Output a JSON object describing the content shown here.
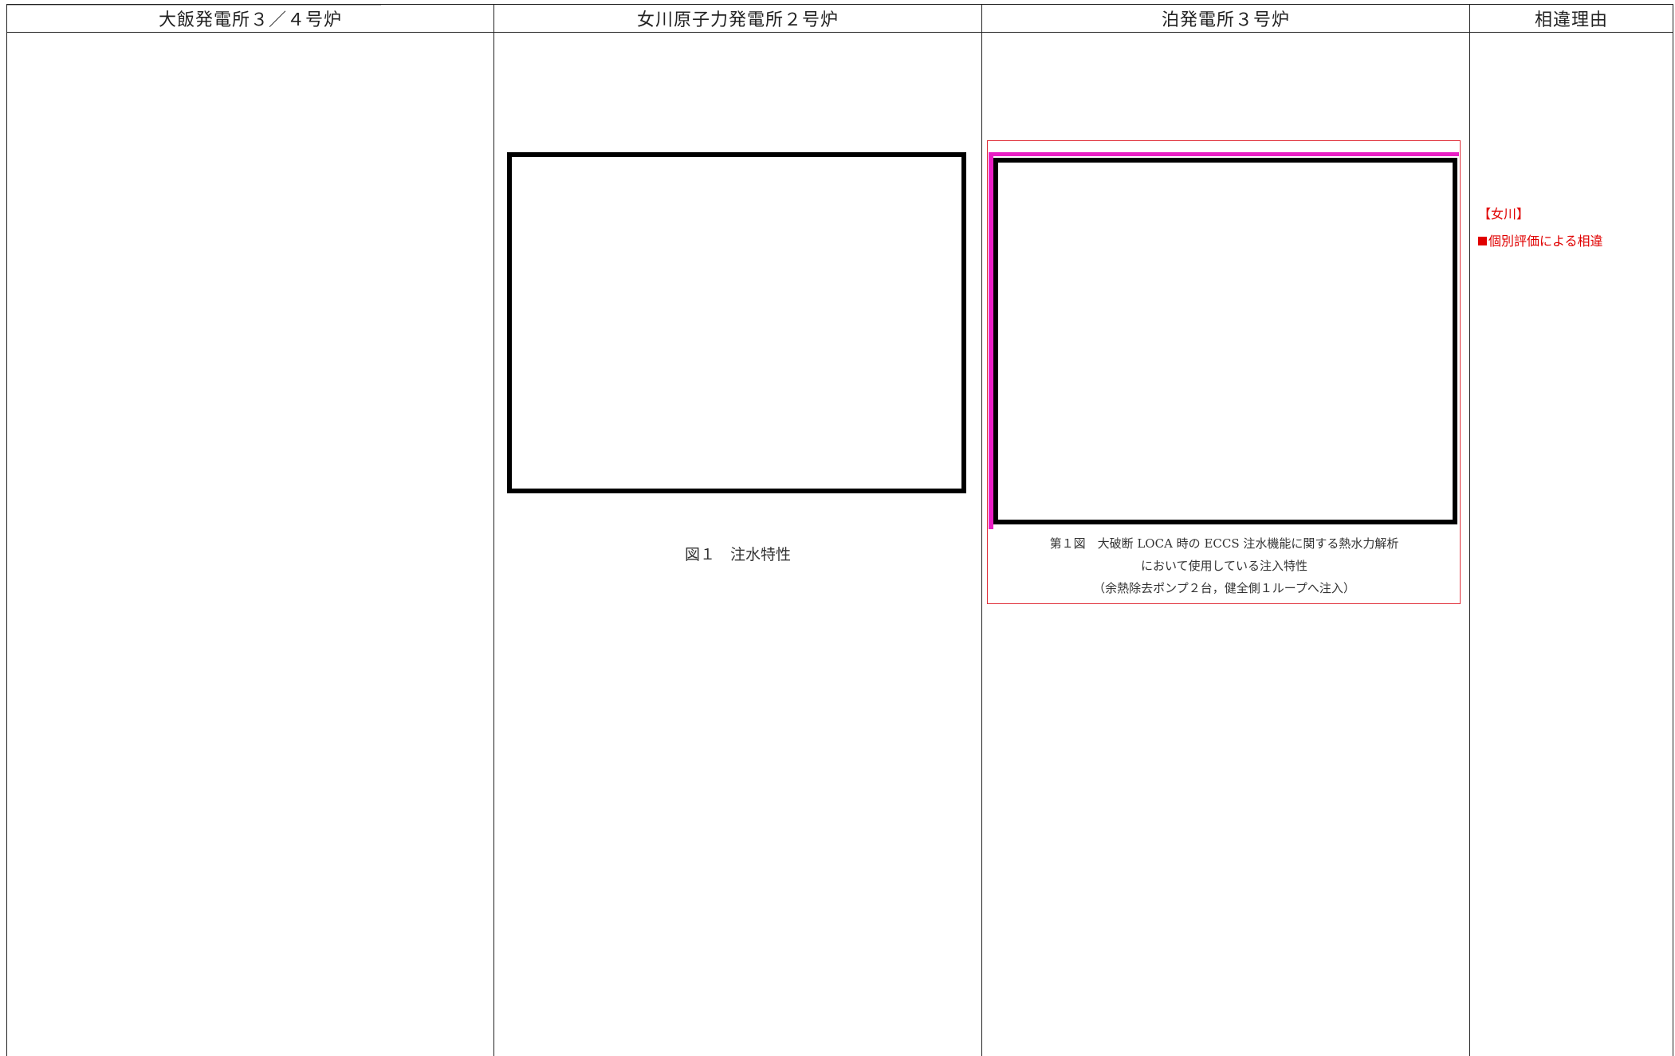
{
  "table": {
    "headers": [
      "大飯発電所３／４号炉",
      "女川原子力発電所２号炉",
      "泊発電所３号炉",
      "相違理由"
    ]
  },
  "onagawa": {
    "caption": "図１　注水特性"
  },
  "tomari": {
    "caption_lines": [
      "第１図　大破断 LOCA 時の ECCS 注水機能に関する熱水力解析",
      "において使用している注入特性",
      "（余熱除去ポンプ２台，健全側１ループへ注入）"
    ]
  },
  "reason": {
    "tag": "【女川】",
    "item": "個別評価による相違"
  },
  "colors": {
    "reason_red": "#e00000",
    "magenta_marker": "#e91ec4",
    "red_frame": "#e0303a"
  }
}
